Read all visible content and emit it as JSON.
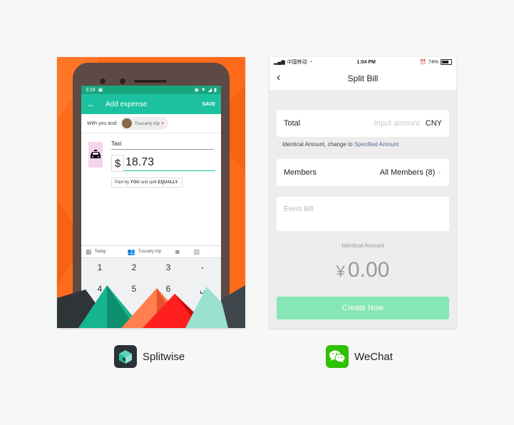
{
  "splitwise": {
    "status_time": "3:18",
    "title": "Add expense",
    "save": "SAVE",
    "with_label": "With you and:",
    "group_chip": "Tuscany trip",
    "description": "Taxi",
    "currency_symbol": "$",
    "amount": "18.73",
    "paid_prefix": "Paid by ",
    "paid_you": "YOU",
    "paid_mid": " and split ",
    "paid_equally": "EQUALLY",
    "paid_suffix": ".",
    "date": "Today",
    "group": "Tuscany trip",
    "keys": [
      "1",
      "2",
      "3",
      "-",
      "4",
      "5",
      "6",
      "␣"
    ],
    "brand_color": "#1cc29f",
    "background_color": "#ff6b1a"
  },
  "wechat": {
    "carrier": "中国移动",
    "time": "1:04 PM",
    "battery": "74%",
    "title": "Split Bill",
    "total_label": "Total",
    "total_placeholder": "Input amount",
    "currency": "CNY",
    "note_prefix": "Identical Amount, change to ",
    "note_link": "Specified Amount",
    "members_label": "Members",
    "members_value": "All Members (8)",
    "event_placeholder": "Event Bill",
    "identical_label": "Identical Amount",
    "amount_symbol": "¥",
    "amount_value": "0.00",
    "create_button": "Create Now",
    "accent_color": "#86e6b4"
  },
  "captions": {
    "splitwise": "Splitwise",
    "wechat": "WeChat"
  }
}
